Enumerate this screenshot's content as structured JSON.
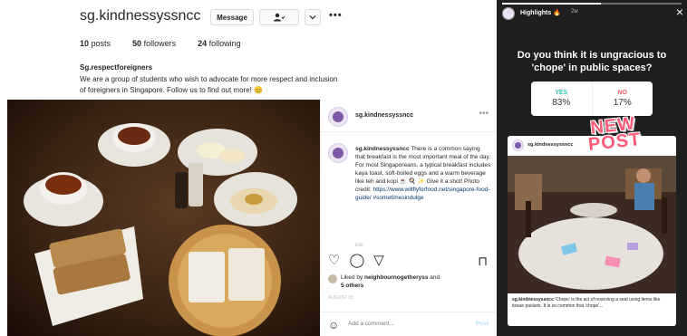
{
  "profile": {
    "username": "sg.kindnessyssncc",
    "message_button": "Message",
    "follow_icon": "person-check-icon",
    "more_label": "•••",
    "stats": [
      {
        "count": "10",
        "label": "posts"
      },
      {
        "count": "50",
        "label": "followers"
      },
      {
        "count": "24",
        "label": "following"
      }
    ],
    "bio_name": "Sg.respectforeigners",
    "bio_text": "We are a group of students who wish to advocate for more respect and inclusion of foreigners in Singapore. Follow us to find out more! 😊"
  },
  "post": {
    "username": "sg.kindnessyssncc",
    "more_label": "•••",
    "caption_user": "sg.kindnessyssncc",
    "caption_text": "There is a common saying that breakfast is the most important meal of the day. For most Singaporeans, a typical breakfast includes kaya toast, soft-boiled eggs and a warm beverage like teh and kopi ☕ 🍳 ✨ Give it a shot! Photo credit:",
    "caption_link": "https://www.willflyforfood.net/singapore-food-guide/",
    "caption_tag": "#sometimesindulge",
    "caption_time_small": "Edit",
    "liked_by_prefix": "Liked by",
    "liked_by_user": "neighbournogetheryss",
    "liked_by_suffix": "and",
    "liked_by_others": "5 others",
    "date": "AUGUST 15",
    "comment_placeholder": "Add a comment...",
    "comment_post": "Post"
  },
  "story": {
    "title": "Highlights 🔥",
    "time": "2w",
    "close_label": "×",
    "question": "Do you think it is ungracious to 'chope' in public spaces?",
    "poll": [
      {
        "label": "YES",
        "percent": "83%",
        "value": 83,
        "color": "#36c9b8"
      },
      {
        "label": "NO",
        "percent": "17%",
        "value": 17,
        "color": "#f0606f"
      }
    ],
    "sticker_line1": "NEW",
    "sticker_line2": "POST",
    "repost_user": "sg.kindnessyssncc",
    "repost_caption_user": "sg.kindnessyssncc",
    "repost_caption_text": "'Chope' is the act of reserving a seat using items like tissue packets. It is so common that 'chope'..."
  },
  "colors": {
    "poll_yes": "#36c9b8",
    "poll_no": "#f0606f",
    "sticker": "#ff5a7a",
    "link": "#00376b"
  }
}
